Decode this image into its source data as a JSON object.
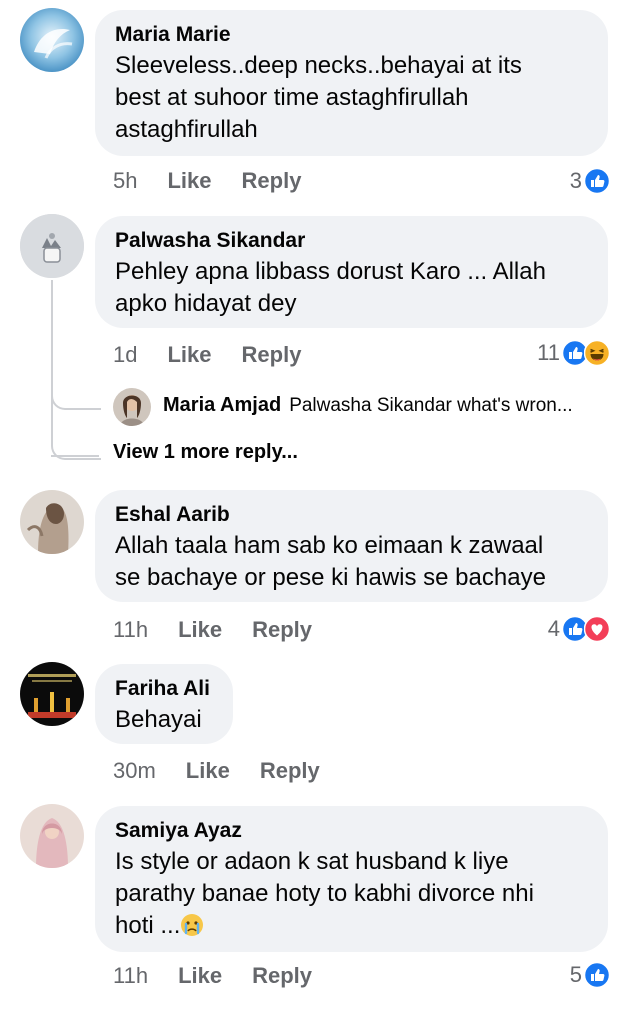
{
  "comments": [
    {
      "author": "Maria Marie",
      "text": "Sleeveless..deep necks..behayai at its\nbest at suhoor time astaghfirullah\nastaghfirullah",
      "time": "5h",
      "like": "Like",
      "reply": "Reply",
      "react_count": "3",
      "reactions": [
        "like-icon"
      ]
    },
    {
      "author": "Palwasha Sikandar",
      "text": "Pehley apna libbass dorust Karo ... Allah\napko hidayat dey",
      "time": "1d",
      "like": "Like",
      "reply": "Reply",
      "react_count": "11",
      "reactions": [
        "like-icon",
        "haha-icon"
      ],
      "reply_preview": {
        "author": "Maria Amjad",
        "text": "Palwasha Sikandar what's wron..."
      },
      "view_more": "View 1 more reply..."
    },
    {
      "author": "Eshal Aarib",
      "text": "Allah taala ham sab ko eimaan k zawaal\nse bachaye or pese ki hawis se bachaye",
      "time": "11h",
      "like": "Like",
      "reply": "Reply",
      "react_count": "4",
      "reactions": [
        "like-icon",
        "love-icon"
      ]
    },
    {
      "author": "Fariha Ali",
      "text": "Behayai",
      "time": "30m",
      "like": "Like",
      "reply": "Reply"
    },
    {
      "author": "Samiya Ayaz",
      "text": "Is style or adaon k sat husband k liye\nparathy banae hoty to kabhi divorce nhi\nhoti ...",
      "time": "11h",
      "like": "Like",
      "reply": "Reply",
      "react_count": "5",
      "reactions": [
        "like-icon"
      ],
      "inline_emoji": "crying-face-icon"
    }
  ],
  "colors": {
    "bubble": "#f0f2f5",
    "meta_text": "#65676b",
    "like_blue": "#1877f2",
    "love_red": "#f33e58",
    "haha_yellow": "#f7b125"
  }
}
